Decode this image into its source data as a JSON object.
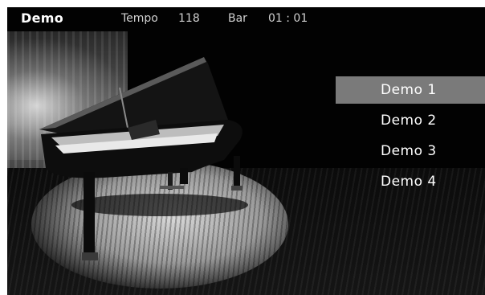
{
  "header": {
    "title": "Demo",
    "tempo_label": "Tempo",
    "tempo_value": "118",
    "bar_label": "Bar",
    "bar_value": "01 : 01"
  },
  "menu": {
    "items": [
      {
        "label": "Demo 1",
        "selected": true
      },
      {
        "label": "Demo 2",
        "selected": false
      },
      {
        "label": "Demo 3",
        "selected": false
      },
      {
        "label": "Demo 4",
        "selected": false
      }
    ]
  },
  "colors": {
    "screen_background": "#020202",
    "selection_highlight": "#7a7a7a",
    "text": "#ffffff"
  },
  "background_image": "grand-piano-on-stage-spotlight"
}
